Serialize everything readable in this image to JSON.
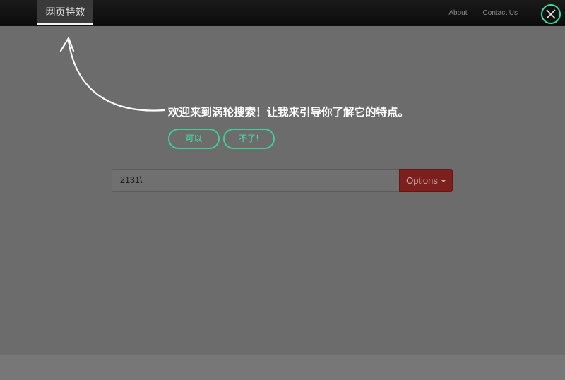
{
  "navbar": {
    "brand": "网页特效",
    "links": [
      "About",
      "Contact Us"
    ]
  },
  "close": {
    "icon": "close-icon",
    "accent": "#3ed8a0"
  },
  "tour": {
    "message": "欢迎来到涡轮搜索！让我来引导你了解它的特点。",
    "yes_label": "可以",
    "no_label": "不了!"
  },
  "search": {
    "value": "2131\\",
    "options_label": "Options"
  },
  "colors": {
    "overlay": "#6b6b6b",
    "accent_green": "#3fcf97",
    "options_red": "#7c1f1f"
  }
}
